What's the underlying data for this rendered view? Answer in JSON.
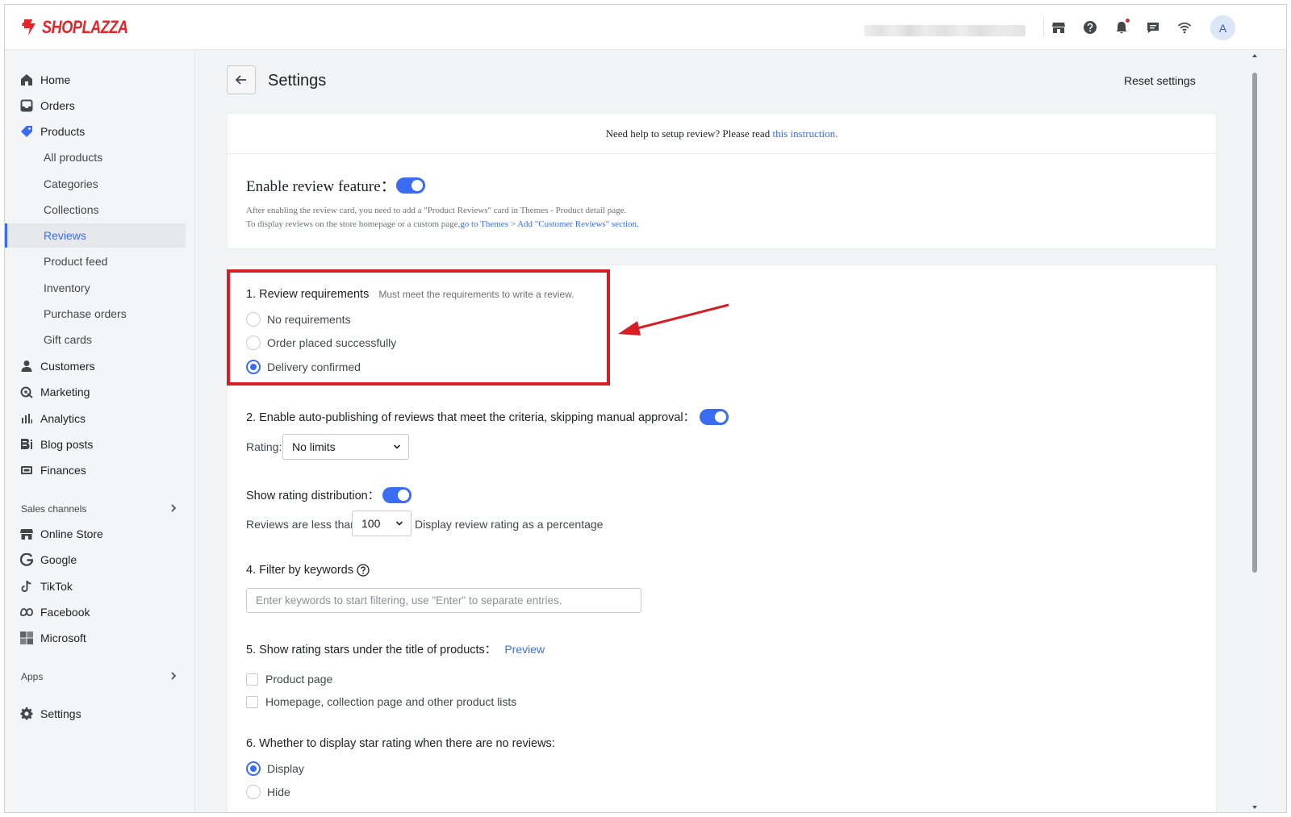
{
  "brand": {
    "name": "SHOPLAZZA",
    "color": "#e0262b",
    "accent": "#3a6cf4"
  },
  "topbar": {
    "icons": [
      "store-icon",
      "help-icon",
      "bell-icon",
      "chat-icon",
      "wifi-icon"
    ],
    "avatar_initial": "A"
  },
  "sidebar": {
    "items": [
      {
        "label": "Home",
        "icon": "home-icon"
      },
      {
        "label": "Orders",
        "icon": "orders-icon"
      },
      {
        "label": "Products",
        "icon": "tag-icon"
      },
      {
        "label": "All products"
      },
      {
        "label": "Categories"
      },
      {
        "label": "Collections"
      },
      {
        "label": "Reviews",
        "active": true
      },
      {
        "label": "Product feed"
      },
      {
        "label": "Inventory"
      },
      {
        "label": "Purchase orders"
      },
      {
        "label": "Gift cards"
      },
      {
        "label": "Customers",
        "icon": "person-icon"
      },
      {
        "label": "Marketing",
        "icon": "marketing-icon"
      },
      {
        "label": "Analytics",
        "icon": "analytics-icon"
      },
      {
        "label": "Blog posts",
        "icon": "blog-icon"
      },
      {
        "label": "Finances",
        "icon": "finances-icon"
      }
    ],
    "sales_channels_label": "Sales channels",
    "channels": [
      {
        "label": "Online Store",
        "icon": "store-icon"
      },
      {
        "label": "Google",
        "icon": "google-icon"
      },
      {
        "label": "TikTok",
        "icon": "tiktok-icon"
      },
      {
        "label": "Facebook",
        "icon": "meta-icon"
      },
      {
        "label": "Microsoft",
        "icon": "microsoft-icon"
      }
    ],
    "apps_label": "Apps",
    "settings_label": "Settings"
  },
  "header": {
    "title": "Settings",
    "reset_label": "Reset settings"
  },
  "intro": {
    "help_text": "Need help to setup review? Please read ",
    "help_link": "this instruction.",
    "enable_label": "Enable review feature：",
    "enable_on": true,
    "desc_line1": "After enabling the review card, you need to add a \"Product Reviews\" card in Themes - Product detail page.",
    "desc_line2_prefix": "To display reviews on the store homepage or a custom page,",
    "desc_line2_link": "go to Themes > Add \"Customer Reviews\" section."
  },
  "settings": {
    "s1_title": "1. Review requirements",
    "s1_hint": "Must meet the requirements to write a review.",
    "s1_options": [
      {
        "label": "No requirements",
        "selected": false
      },
      {
        "label": "Order placed successfully",
        "selected": false
      },
      {
        "label": "Delivery confirmed",
        "selected": true
      }
    ],
    "s2_title": "2. Enable auto-publishing of reviews that meet the criteria, skipping manual approval：",
    "s2_on": true,
    "rating_label": "Rating:",
    "rating_value": "No limits",
    "s3_title": "Show rating distribution：",
    "s3_on": true,
    "reviews_less_than_label": "Reviews are less than",
    "reviews_less_than_value": "100",
    "display_percentage_label": "Display review rating as a percentage",
    "s4_title": "4. Filter by keywords",
    "s4_placeholder": "Enter keywords to start filtering, use \"Enter\" to separate entries.",
    "s5_title": "5. Show rating stars under the title of products：",
    "s5_preview": "Preview",
    "s5_options": [
      {
        "label": "Product page",
        "checked": false
      },
      {
        "label": "Homepage, collection page and other product lists",
        "checked": false
      }
    ],
    "s6_title": "6. Whether to display star rating when there are no reviews:",
    "s6_options": [
      {
        "label": "Display",
        "selected": true
      },
      {
        "label": "Hide",
        "selected": false
      }
    ]
  },
  "annotation": {
    "color": "#d81e25"
  }
}
